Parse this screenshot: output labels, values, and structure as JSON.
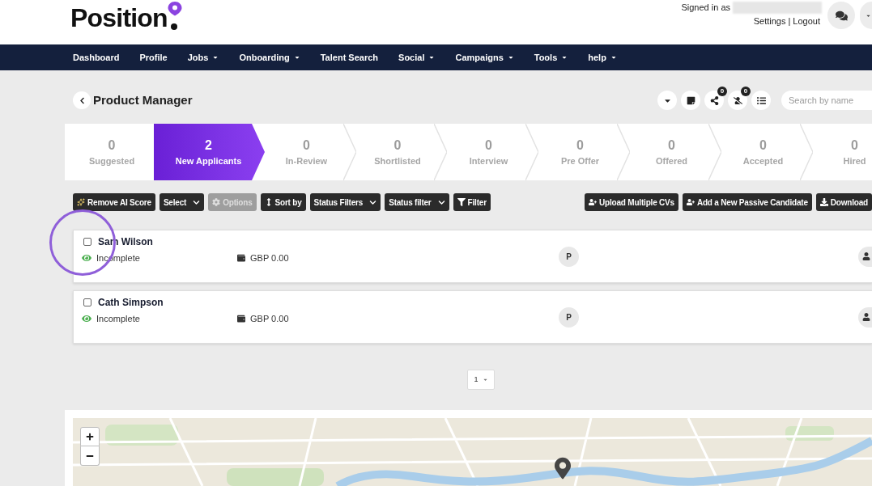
{
  "header": {
    "logo": "Position",
    "signed_in_label": "Signed in as",
    "user_name_hidden": true,
    "settings_link": "Settings",
    "separator": "|",
    "logout_link": "Logout"
  },
  "nav": [
    {
      "label": "Dashboard",
      "dropdown": false
    },
    {
      "label": "Profile",
      "dropdown": false
    },
    {
      "label": "Jobs",
      "dropdown": true
    },
    {
      "label": "Onboarding",
      "dropdown": true
    },
    {
      "label": "Talent Search",
      "dropdown": false
    },
    {
      "label": "Social",
      "dropdown": true
    },
    {
      "label": "Campaigns",
      "dropdown": true
    },
    {
      "label": "Tools",
      "dropdown": true
    },
    {
      "label": "help",
      "dropdown": true
    }
  ],
  "job": {
    "title": "Product Manager",
    "actions": [
      {
        "kind": "menu"
      },
      {
        "kind": "note"
      },
      {
        "kind": "share",
        "badge": "0"
      },
      {
        "kind": "hide",
        "badge": "0"
      },
      {
        "kind": "list"
      }
    ],
    "search": {
      "placeholder": "Search by name"
    }
  },
  "pipeline": [
    {
      "count": "0",
      "label": "Suggested",
      "selected": false
    },
    {
      "count": "2",
      "label": "New Applicants",
      "selected": true
    },
    {
      "count": "0",
      "label": "In-Review",
      "selected": false
    },
    {
      "count": "0",
      "label": "Shortlisted",
      "selected": false
    },
    {
      "count": "0",
      "label": "Interview",
      "selected": false
    },
    {
      "count": "0",
      "label": "Pre Offer",
      "selected": false
    },
    {
      "count": "0",
      "label": "Offered",
      "selected": false
    },
    {
      "count": "0",
      "label": "Accepted",
      "selected": false
    },
    {
      "count": "0",
      "label": "Hired",
      "selected": false
    }
  ],
  "toolbar": {
    "left": [
      {
        "kind": "ai",
        "label": "Remove AI Score",
        "disabled": false
      },
      {
        "kind": "dropdown",
        "label": "Select",
        "disabled": false
      },
      {
        "kind": "options",
        "label": "Options",
        "disabled": true
      },
      {
        "kind": "sort",
        "label": "Sort by",
        "disabled": false
      },
      {
        "kind": "dropdown",
        "label": "Status Filters",
        "disabled": false
      },
      {
        "kind": "dropdown",
        "label": "Status filter",
        "disabled": false
      },
      {
        "kind": "filter",
        "label": "Filter",
        "disabled": false
      }
    ],
    "right": [
      {
        "kind": "upload",
        "label": "Upload Multiple CVs",
        "disabled": false
      },
      {
        "kind": "add",
        "label": "Add a New Passive Candidate",
        "disabled": false
      },
      {
        "kind": "download",
        "label": "Download",
        "disabled": false
      }
    ]
  },
  "candidates": [
    {
      "name": "Sam Wilson",
      "checked": false,
      "highlighted": true,
      "status": "Incomplete",
      "amount": "GBP 0.00",
      "initial": "P"
    },
    {
      "name": "Cath Simpson",
      "checked": false,
      "highlighted": false,
      "status": "Incomplete",
      "amount": "GBP 0.00",
      "initial": "P"
    }
  ],
  "pagination": {
    "page": "1"
  }
}
